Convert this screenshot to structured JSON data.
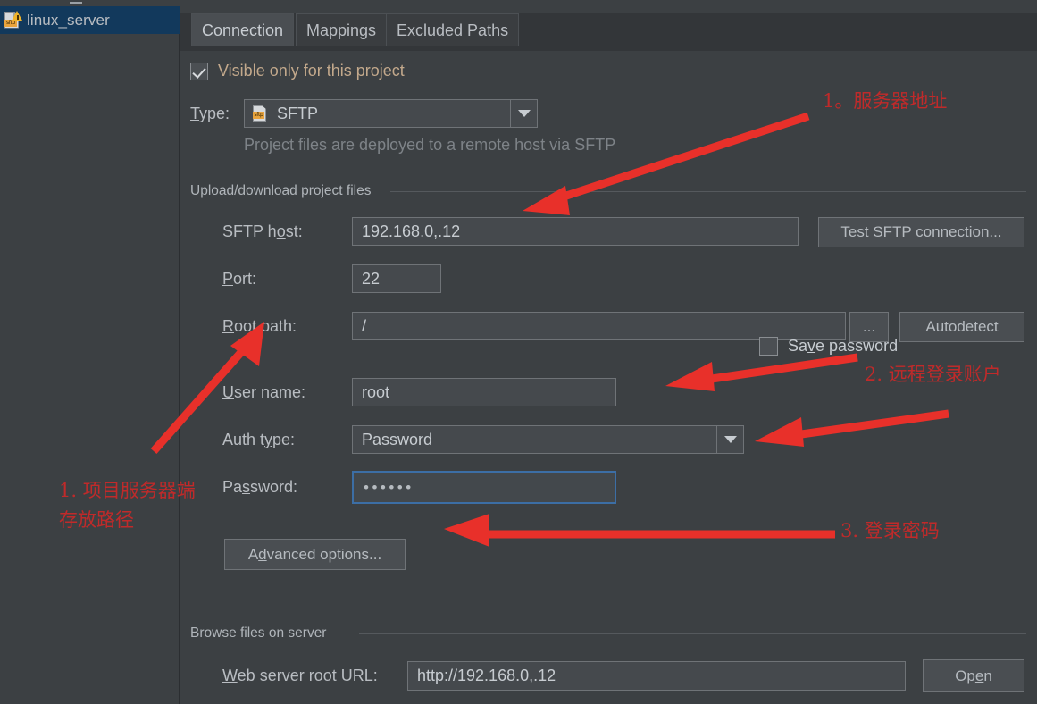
{
  "sidebar": {
    "item": {
      "label": "linux_server",
      "icon": "sftp-server-icon",
      "badge": "sftp"
    }
  },
  "tabs": [
    {
      "label": "Connection",
      "selected": true
    },
    {
      "label": "Mappings",
      "selected": false
    },
    {
      "label": "Excluded Paths",
      "selected": false
    }
  ],
  "form": {
    "visible_only_checkbox": {
      "label": "Visible only for this project",
      "checked": true
    },
    "type": {
      "label": "Type:",
      "value": "SFTP",
      "icon_badge": "sftp"
    },
    "type_hint": "Project files are deployed to a remote host via SFTP",
    "upload_group": {
      "title": "Upload/download project files"
    },
    "sftp_host": {
      "label": "SFTP host:",
      "value": "192.168.0,.12"
    },
    "test_connection_button": "Test SFTP connection...",
    "port": {
      "label": "Port:",
      "value": "22"
    },
    "root_path": {
      "label": "Root path:",
      "value": "/"
    },
    "browse_button": "...",
    "autodetect_button": "Autodetect",
    "user_name": {
      "label": "User name:",
      "value": "root"
    },
    "auth_type": {
      "label": "Auth type:",
      "value": "Password"
    },
    "password": {
      "label": "Password:",
      "value": "••••••",
      "masked_count": 6
    },
    "save_password_checkbox": {
      "label": "Save password",
      "checked": false
    },
    "advanced_options_button": "Advanced options...",
    "browse_group": {
      "title": "Browse files on server"
    },
    "web_server_root_url": {
      "label": "Web server root URL:",
      "value": "http://192.168.0,.12"
    },
    "open_button": "Open"
  },
  "annotations": {
    "server_address": "1。服务器地址",
    "remote_account": "2. 远程登录账户",
    "login_password": "3. 登录密码",
    "project_path_line1": "1. 项目服务器端",
    "project_path_line2": "存放路径"
  },
  "colors": {
    "background": "#3c4043",
    "panel_tab_strip": "#333639",
    "field_background": "#45494d",
    "accent_blue": "#3c6ea5",
    "annotation_red": "#c02a2a",
    "sidebar_selection": "#12395c",
    "badge_orange": "#e8a33d"
  }
}
